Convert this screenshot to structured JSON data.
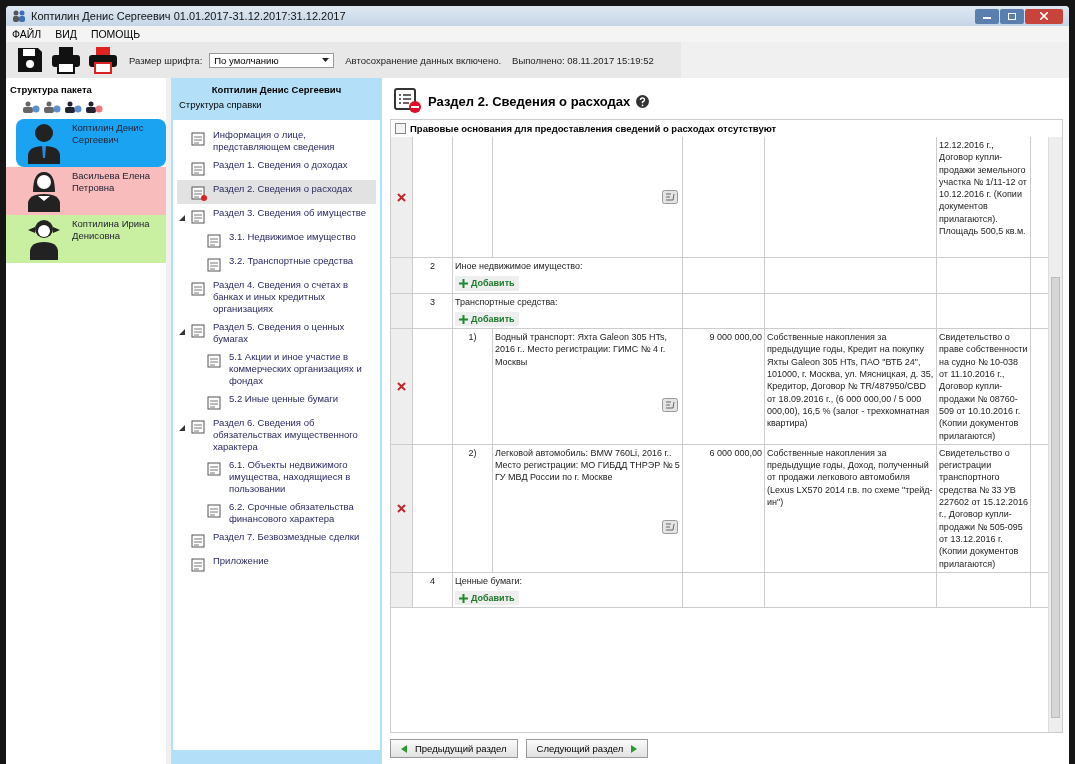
{
  "window": {
    "title": "Коптилин Денис Сергеевич 01.01.2017-31.12.2017:31.12.2017"
  },
  "menu": [
    "ФАЙЛ",
    "ВИД",
    "ПОМОЩЬ"
  ],
  "toolbar": {
    "font_size_label": "Размер шрифта:",
    "font_size_value": "По умолчанию",
    "autosave": "Автосохранение данных включено.",
    "completed": "Выполнено: 08.11.2017 15:19:52"
  },
  "package": {
    "title": "Структура пакета",
    "members": [
      {
        "name": "Коптилин Денис Сергеевич",
        "kind": "man",
        "color": "#1aa3f0",
        "selected": true
      },
      {
        "name": "Васильева Елена Петровна",
        "kind": "woman",
        "color": "#f8bcbc",
        "selected": false
      },
      {
        "name": "Коптилина Ирина Денисовна",
        "kind": "girl",
        "color": "#c8f0a0",
        "selected": false
      }
    ]
  },
  "structure": {
    "person": "Коптилин Денис Сергеевич",
    "subtitle": "Структура справки",
    "items": [
      {
        "label": "Информация о лице, представляющем сведения",
        "selected": false
      },
      {
        "label": "Раздел 1. Сведения о доходах",
        "selected": false
      },
      {
        "label": "Раздел 2. Сведения о расходах",
        "selected": true
      },
      {
        "label": "Раздел 3. Сведения об имуществе",
        "selected": false,
        "expanded": true,
        "children": [
          {
            "label": "3.1. Недвижимое имущество",
            "selected": false
          },
          {
            "label": "3.2. Транспортные средства",
            "selected": false
          }
        ]
      },
      {
        "label": "Раздел 4. Сведения о счетах в банках и иных кредитных организациях",
        "selected": false
      },
      {
        "label": "Раздел 5. Сведения о ценных бумагах",
        "selected": false,
        "expanded": true,
        "children": [
          {
            "label": "5.1 Акции и иное участие в коммерческих организациях и фондах",
            "selected": false
          },
          {
            "label": "5.2 Иные ценные бумаги",
            "selected": false
          }
        ]
      },
      {
        "label": "Раздел 6. Сведения об обязательствах имущественного характера",
        "selected": false,
        "expanded": true,
        "children": [
          {
            "label": "6.1. Объекты недвижимого имущества, находящиеся в пользовании",
            "selected": false
          },
          {
            "label": "6.2. Срочные обязательства финансового характера",
            "selected": false
          }
        ]
      },
      {
        "label": "Раздел 7. Безвозмездные сделки",
        "selected": false
      },
      {
        "label": "Приложение",
        "selected": false
      }
    ]
  },
  "section": {
    "title": "Раздел 2. Сведения о расходах",
    "no_grounds": {
      "label": "Правовые основания для предоставления сведений о расходах отсутствуют",
      "checked": false
    },
    "rows": [
      {
        "kind": "continuation",
        "documents": "12.12.2016 г., Договор купли-продажи земельного участка № 1/11-12 от 10.12.2016 г. (Копии документов прилагаются). Площадь 500,5 кв.м."
      },
      {
        "kind": "category",
        "number": "2",
        "label": "Иное недвижимое имущество:",
        "add": "Добавить"
      },
      {
        "kind": "category",
        "number": "3",
        "label": "Транспортные средства:",
        "add": "Добавить"
      },
      {
        "kind": "item",
        "number": "1)",
        "description": "Водный транспорт: Яхта Galeon 305 HTs, 2016 г.. Место регистрации: ГИМС № 4 г. Москвы",
        "amount": "9 000 000,00",
        "source": "Собственные накопления за предыдущие годы, Кредит на покупку Яхты Galeon 305 HTs, ПАО \"ВТБ 24\", 101000, г. Москва, ул. Мясницкая, д. 35, Кредитор, Договор № TR/487950/CBD от 18.09.2016 г., (6 000 000,00 / 5 000 000,00), 16,5 % (залог - трехкомнатная квартира)",
        "documents": "Свидетельство о праве собственности на судно № 10-038 от 11.10.2016 г., Договор купли-продажи № 08760-509 от 10.10.2016 г. (Копии документов прилагаются)"
      },
      {
        "kind": "item",
        "number": "2)",
        "description": "Легковой автомобиль: BMW 760Li, 2016 г.. Место регистрации: МО ГИБДД ТНРЭР № 5 ГУ МВД России по г. Москве",
        "amount": "6 000 000,00",
        "source": "Собственные накопления за предыдущие годы, Доход, полученный от продажи легкового автомобиля (Lexus LX570 2014 г.в. по схеме \"трейд-ин\")",
        "documents": "Свидетельство о регистрации транспортного средства № 33 УВ 227602 от 15.12.2016 г., Договор купли-продажи № 505-095 от 13.12.2016 г. (Копии документов прилагаются)"
      },
      {
        "kind": "category",
        "number": "4",
        "label": "Ценные бумаги:",
        "add": "Добавить"
      }
    ],
    "prev": "Предыдущий раздел",
    "next": "Следующий раздел"
  }
}
